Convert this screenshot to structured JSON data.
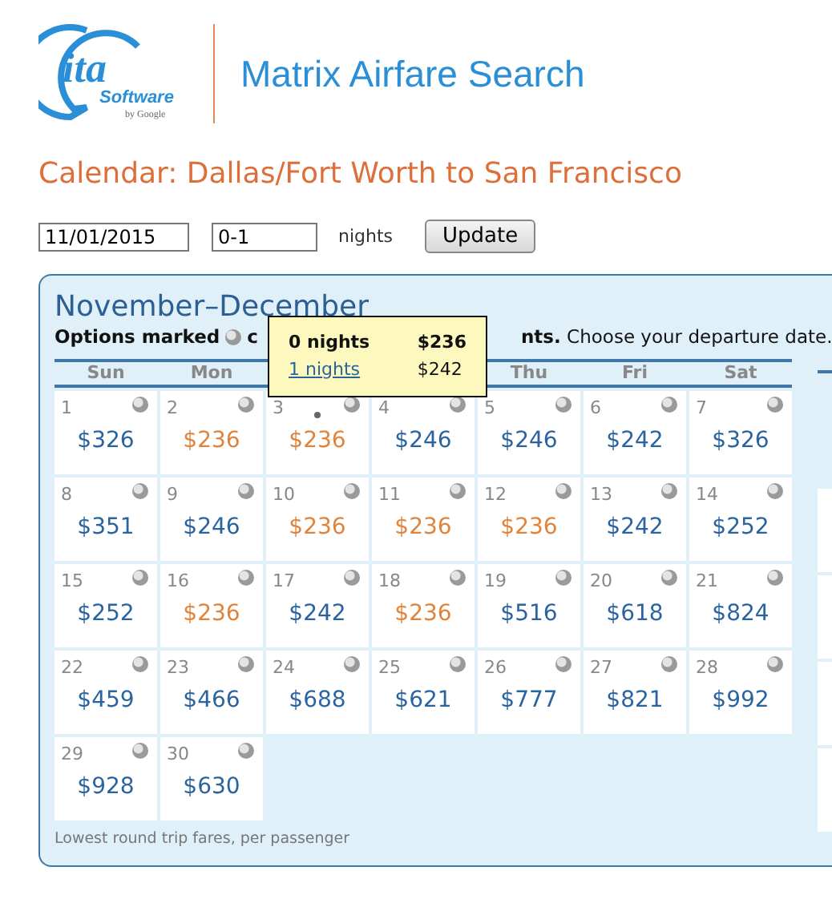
{
  "logo": {
    "mark": "ita",
    "word": "Software",
    "byline": "by Google"
  },
  "app_title": "Matrix Airfare Search",
  "page_title": "Calendar: Dallas/Fort Worth to San Francisco",
  "form": {
    "date": "11/01/2015",
    "nights": "0-1",
    "nights_label": "nights",
    "button": "Update"
  },
  "calendar": {
    "month_title": "November–December",
    "note_start": "Options marked",
    "note_cut": "c",
    "note_end": "**nts.** Choose your departure date.",
    "day_headers": [
      "Sun",
      "Mon",
      "Thu",
      "Fri",
      "Sat"
    ],
    "days": [
      {
        "date": "1",
        "price": "$326",
        "cheapest": false,
        "hovered": false
      },
      {
        "date": "2",
        "price": "$236",
        "cheapest": true,
        "hovered": false
      },
      {
        "date": "3",
        "price": "$236",
        "cheapest": true,
        "hovered": true
      },
      {
        "date": "4",
        "price": "$246",
        "cheapest": false,
        "hovered": false
      },
      {
        "date": "5",
        "price": "$246",
        "cheapest": false,
        "hovered": false
      },
      {
        "date": "6",
        "price": "$242",
        "cheapest": false,
        "hovered": false
      },
      {
        "date": "7",
        "price": "$326",
        "cheapest": false,
        "hovered": false
      },
      {
        "date": "8",
        "price": "$351",
        "cheapest": false,
        "hovered": false
      },
      {
        "date": "9",
        "price": "$246",
        "cheapest": false,
        "hovered": false
      },
      {
        "date": "10",
        "price": "$236",
        "cheapest": true,
        "hovered": false
      },
      {
        "date": "11",
        "price": "$236",
        "cheapest": true,
        "hovered": false
      },
      {
        "date": "12",
        "price": "$236",
        "cheapest": true,
        "hovered": false
      },
      {
        "date": "13",
        "price": "$242",
        "cheapest": false,
        "hovered": false
      },
      {
        "date": "14",
        "price": "$252",
        "cheapest": false,
        "hovered": false
      },
      {
        "date": "15",
        "price": "$252",
        "cheapest": false,
        "hovered": false
      },
      {
        "date": "16",
        "price": "$236",
        "cheapest": true,
        "hovered": false
      },
      {
        "date": "17",
        "price": "$242",
        "cheapest": false,
        "hovered": false
      },
      {
        "date": "18",
        "price": "$236",
        "cheapest": true,
        "hovered": false
      },
      {
        "date": "19",
        "price": "$516",
        "cheapest": false,
        "hovered": false
      },
      {
        "date": "20",
        "price": "$618",
        "cheapest": false,
        "hovered": false
      },
      {
        "date": "21",
        "price": "$824",
        "cheapest": false,
        "hovered": false
      },
      {
        "date": "22",
        "price": "$459",
        "cheapest": false,
        "hovered": false
      },
      {
        "date": "23",
        "price": "$466",
        "cheapest": false,
        "hovered": false
      },
      {
        "date": "24",
        "price": "$688",
        "cheapest": false,
        "hovered": false
      },
      {
        "date": "25",
        "price": "$621",
        "cheapest": false,
        "hovered": false
      },
      {
        "date": "26",
        "price": "$777",
        "cheapest": false,
        "hovered": false
      },
      {
        "date": "27",
        "price": "$821",
        "cheapest": false,
        "hovered": false
      },
      {
        "date": "28",
        "price": "$992",
        "cheapest": false,
        "hovered": false
      },
      {
        "date": "29",
        "price": "$928",
        "cheapest": false,
        "hovered": false
      },
      {
        "date": "30",
        "price": "$630",
        "cheapest": false,
        "hovered": false
      }
    ],
    "footnote": "Lowest round trip fares, per passenger"
  },
  "tooltip": {
    "rows": [
      {
        "nights": "0 nights",
        "price": "$236",
        "selected": true
      },
      {
        "nights": "1 nights",
        "price": "$242",
        "selected": false
      }
    ]
  }
}
